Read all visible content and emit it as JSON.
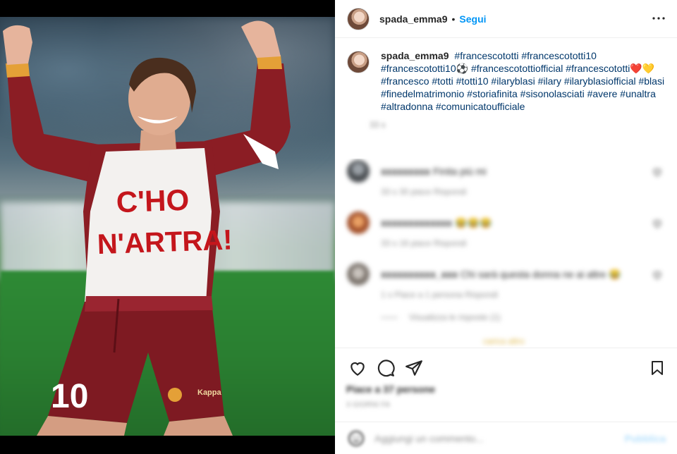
{
  "post": {
    "username": "spada_emma9",
    "follow_label": "Segui",
    "separator": "•"
  },
  "photo": {
    "shirt_line1": "C'HO",
    "shirt_line2": "N'ARTRA!",
    "shorts_number": "10",
    "brand": "Kappa"
  },
  "caption": {
    "username": "spada_emma9",
    "text": "#francescototti #francescototti10 #francescototti10⚽ #francescotottiofficial #francescototti❤️💛 #francesco #totti #totti10 #ilaryblasi #ilary #ilaryblasiofficial #blasi #finedelmatrimonio #storiafinita #sisonolasciati #avere #unaltra #altradonna #comunicatoufficiale",
    "time": "33 s"
  },
  "comments": [
    {
      "username": "xxxxxxxxx",
      "text": "Finita più mi",
      "meta": "33 s   30 piace   Rispondi"
    },
    {
      "username": "xxxxxxxxxxxxx",
      "text": "😂😂😂",
      "meta": "33 s   16 piace   Rispondi"
    },
    {
      "username": "xxxxxxxxxx_xxx",
      "text": "Chi sarà questa donna ne ai altre 😂",
      "meta": "1 s   Piace a 1 persona   Rispondi"
    }
  ],
  "replies_label": "Visualizza le risposte (1)",
  "load_more_label": "carica altro",
  "footer": {
    "likes": "Piace a 37 persone",
    "date": "3 GIORNI FA",
    "comment_placeholder": "Aggiungi un commento...",
    "post_label": "Pubblica"
  },
  "icons": {
    "more": "more-options-icon",
    "like": "heart-icon",
    "comment": "comment-bubble-icon",
    "share": "paper-plane-icon",
    "save": "bookmark-icon",
    "emoji": "emoji-icon"
  },
  "colors": {
    "accent": "#0095f6",
    "hashtag": "#00376b",
    "jersey": "#8b1d24",
    "shirt_text": "#c4161c"
  }
}
